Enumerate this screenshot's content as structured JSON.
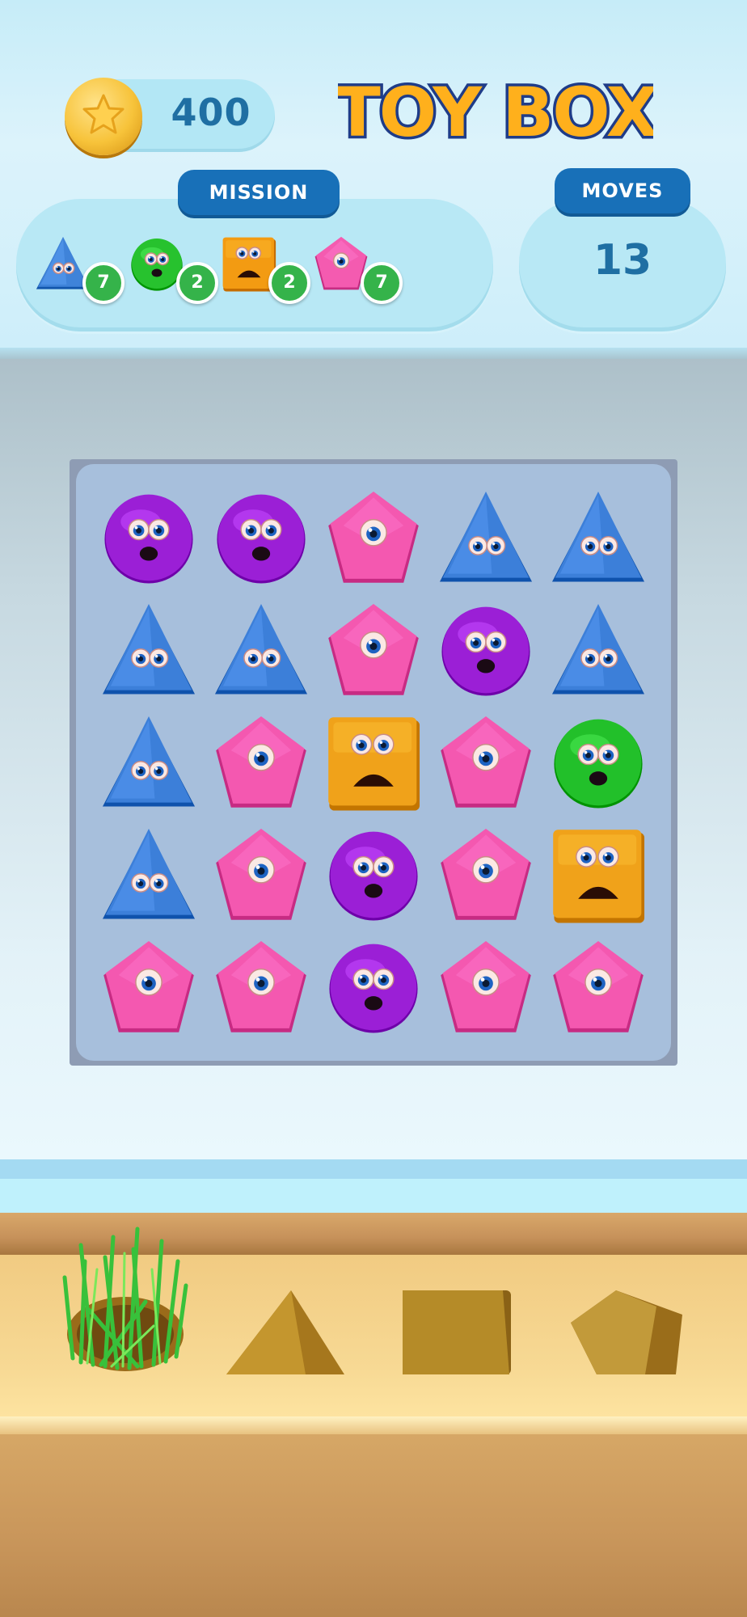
{
  "header": {
    "coins": "400",
    "logo_text": "TOY BOX",
    "mission_label": "MISSION",
    "moves_label": "MOVES",
    "moves_value": "13"
  },
  "mission": [
    {
      "shape": "triangle",
      "color": "#3f83d9",
      "count": "7"
    },
    {
      "shape": "circle",
      "color": "#27c22e",
      "count": "2"
    },
    {
      "shape": "square",
      "color": "#f39b12",
      "count": "2"
    },
    {
      "shape": "pentagon",
      "color": "#f45bb0",
      "count": "7"
    }
  ],
  "board": {
    "rows": 5,
    "cols": 5,
    "cells": [
      [
        "circle-purple",
        "circle-purple",
        "pentagon-pink",
        "triangle-blue",
        "triangle-blue"
      ],
      [
        "triangle-blue",
        "triangle-blue",
        "pentagon-pink",
        "circle-purple",
        "triangle-blue"
      ],
      [
        "triangle-blue",
        "pentagon-pink",
        "square-orange",
        "pentagon-pink",
        "circle-green"
      ],
      [
        "triangle-blue",
        "pentagon-pink",
        "circle-purple",
        "pentagon-pink",
        "square-orange"
      ],
      [
        "pentagon-pink",
        "pentagon-pink",
        "circle-purple",
        "pentagon-pink",
        "pentagon-pink"
      ]
    ]
  },
  "colors": {
    "circle-purple": "#9b1fd6",
    "triangle-blue": "#3c7fd9",
    "pentagon-pink": "#f458b0",
    "square-orange": "#f0a21a",
    "circle-green": "#22c02a",
    "accent_blue": "#1870b8"
  },
  "sorter_slots": [
    "circle-grass-covered",
    "triangle",
    "square",
    "pentagon"
  ]
}
